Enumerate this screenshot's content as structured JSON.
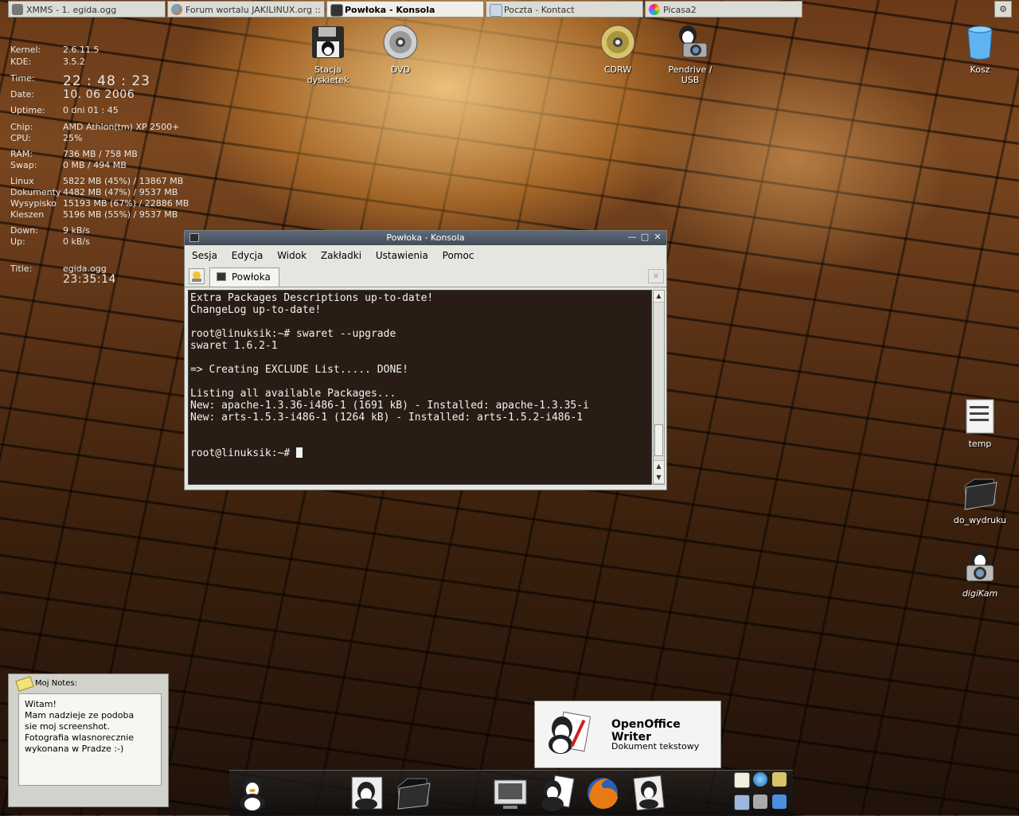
{
  "taskbar": {
    "tasks": [
      {
        "label": "XMMS - 1. egida.ogg",
        "active": false
      },
      {
        "label": "Forum wortalu JAKILINUX.org :: Zob",
        "active": false
      },
      {
        "label": "Powłoka - Konsola",
        "active": true
      },
      {
        "label": "Poczta - Kontact",
        "active": false
      },
      {
        "label": "Picasa2",
        "active": false
      }
    ]
  },
  "sysinfo": {
    "kernel_label": "Kernel:",
    "kernel": "2.6.11.5",
    "kde_label": "KDE:",
    "kde": "3.5.2",
    "time_label": "Time:",
    "time": "22 : 48 : 23",
    "date_label": "Date:",
    "date": "10. 06 2006",
    "uptime_label": "Uptime:",
    "uptime": "0 dni  01 : 45",
    "chip_label": "Chip:",
    "chip": "AMD Athlon(tm) XP 2500+",
    "cpu_label": "CPU:",
    "cpu": "25%",
    "ram_label": "RAM:",
    "ram": "736 MB / 758 MB",
    "swap_label": "Swap:",
    "swap": "0 MB / 494 MB",
    "disks": [
      {
        "label": "Linux",
        "value": "5822 MB (45%) / 13867 MB"
      },
      {
        "label": "Dokumenty",
        "value": "4482 MB (47%) / 9537 MB"
      },
      {
        "label": "Wysypisko",
        "value": "15193 MB (67%) / 22886 MB"
      },
      {
        "label": "Kieszen",
        "value": "5196 MB (55%) / 9537 MB"
      }
    ],
    "down_label": "Down:",
    "down": "9 kB/s",
    "up_label": "Up:",
    "up": "0 kB/s",
    "title_label": "Title:",
    "title": "egida.ogg",
    "track_time": "23:35:14"
  },
  "desktop_icons": {
    "floppy": "Stacja dyskietek",
    "dvd": "DVD",
    "cdrw": "CDRW",
    "usb": "Pendrive / USB",
    "trash": "Kosz",
    "temp": "temp",
    "folder": "do_wydruku",
    "digikam": "digiKam"
  },
  "konsole": {
    "title": "Powłoka - Konsola",
    "menu": [
      "Sesja",
      "Edycja",
      "Widok",
      "Zakładki",
      "Ustawienia",
      "Pomoc"
    ],
    "tab": "Powłoka",
    "lines": [
      "Extra Packages Descriptions up-to-date!",
      "ChangeLog up-to-date!",
      "",
      "root@linuksik:~# swaret --upgrade",
      "swaret 1.6.2-1",
      "",
      "=> Creating EXCLUDE List..... DONE!",
      "",
      "Listing all available Packages...",
      "New: apache-1.3.36-i486-1 (1691 kB) - Installed: apache-1.3.35-i",
      "New: arts-1.5.3-i486-1 (1264 kB) - Installed: arts-1.5.2-i486-1",
      "",
      ""
    ],
    "prompt": "root@linuksik:~# "
  },
  "notes": {
    "title": "Moj Notes:",
    "lines": [
      "Witam!",
      "Mam nadzieje ze podoba",
      "sie moj screenshot.",
      "Fotografia wlasnorecznie",
      "wykonana w Pradze :-)"
    ]
  },
  "popup": {
    "title": "OpenOffice Writer",
    "subtitle": "Dokument tekstowy"
  },
  "colors": {
    "terminal_bg": "#190c04",
    "titlebar": "#4f5865",
    "notes_icon": "#f3e27a"
  }
}
